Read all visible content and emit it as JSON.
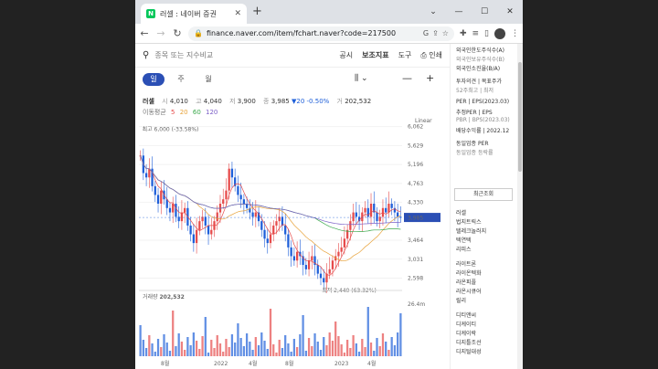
{
  "browser": {
    "tab_title": "러셀 : 네이버 증권",
    "url": "finance.naver.com/item/fchart.naver?code=217500"
  },
  "header": {
    "search_placeholder": "종목 또는 지수비교",
    "links": [
      "공시",
      "보조지표",
      "도구",
      "인쇄"
    ]
  },
  "periods": [
    "일",
    "주",
    "월"
  ],
  "active_period": "일",
  "quote": {
    "name": "러셀",
    "open_label": "시",
    "open": "4,010",
    "high_label": "고",
    "high": "4,040",
    "low_label": "저",
    "low": "3,900",
    "close_label": "종",
    "close": "3,985",
    "change": "▼20",
    "change_pct": "-0.50%",
    "volume_label": "거",
    "volume": "202,532"
  },
  "ma": {
    "label": "이동평균",
    "periods": [
      "5",
      "20",
      "60",
      "120"
    ],
    "colors": [
      "#e64b4b",
      "#e8a33b",
      "#39a84a",
      "#7b5fc7"
    ]
  },
  "colors": {
    "up": "#e64b4b",
    "down": "#1e5fd9",
    "accent": "#2b4fb5"
  },
  "chart_data": {
    "type": "candlestick",
    "scale_label": "Linear",
    "y_ticks": [
      "6,062",
      "5,629",
      "5,196",
      "4,763",
      "4,330",
      "3,464",
      "3,031",
      "2,598"
    ],
    "ylim": [
      2400,
      6200
    ],
    "x_ticks": [
      "8월",
      "2022",
      "4월",
      "8월",
      "2023",
      "4월"
    ],
    "current_price": "3,985",
    "high_annotation": "최고 6,000 (-33.58%)",
    "low_annotation": "최저 2,440 (63.32%)",
    "close_series": [
      5400,
      5000,
      4900,
      5100,
      4700,
      4500,
      4300,
      4600,
      4400,
      4200,
      4100,
      4300,
      4000,
      3900,
      4100,
      4200,
      3800,
      3600,
      3400,
      3700,
      3900,
      4000,
      3800,
      3600,
      3700,
      3900,
      4100,
      4300,
      4400,
      4600,
      5100,
      4900,
      4700,
      4500,
      4400,
      4300,
      4200,
      4100,
      4000,
      4100,
      3900,
      3700,
      3500,
      3400,
      3600,
      3800,
      3900,
      4000,
      3800,
      3600,
      3300,
      3100,
      3000,
      3200,
      3100,
      2900,
      2800,
      3000,
      3100,
      2900,
      2700,
      2600,
      2500,
      2700,
      2800,
      3000,
      3100,
      3200,
      3300,
      3500,
      3700,
      3900,
      4100,
      4000,
      3900,
      4100,
      4200,
      4000,
      4300,
      4100,
      3900,
      4000,
      4200,
      4100,
      4300,
      4200,
      4100,
      4000,
      3985
    ],
    "volume_label": "거래량",
    "volume": "202,532",
    "volume_max_label": "26.4m"
  },
  "right_panel": {
    "lines": [
      "외국인한도주식수(A)",
      "외국인보유주식수(B)",
      "외국인소진율(B/A)",
      "투자의견 | 목표주가",
      "52주최고 | 최저",
      "PER | EPS(2023.03)",
      "추정PER | EPS",
      "PBR | BPS(2023.03)",
      "배당수익률 | 2022.12",
      "동일업종 PER",
      "동일업종 등락률"
    ],
    "recent_tab": "최근조회",
    "recent_items": [
      "러셀",
      "법지트릭스",
      "텔레크놀러지",
      "텍연텍",
      "리피스",
      "라이트론",
      "라이온텍화",
      "라온피플",
      "라온시큐어",
      "릴리",
      "디티앤씨",
      "디케이티",
      "디케이락",
      "디지틀조선",
      "디지털대성"
    ]
  }
}
